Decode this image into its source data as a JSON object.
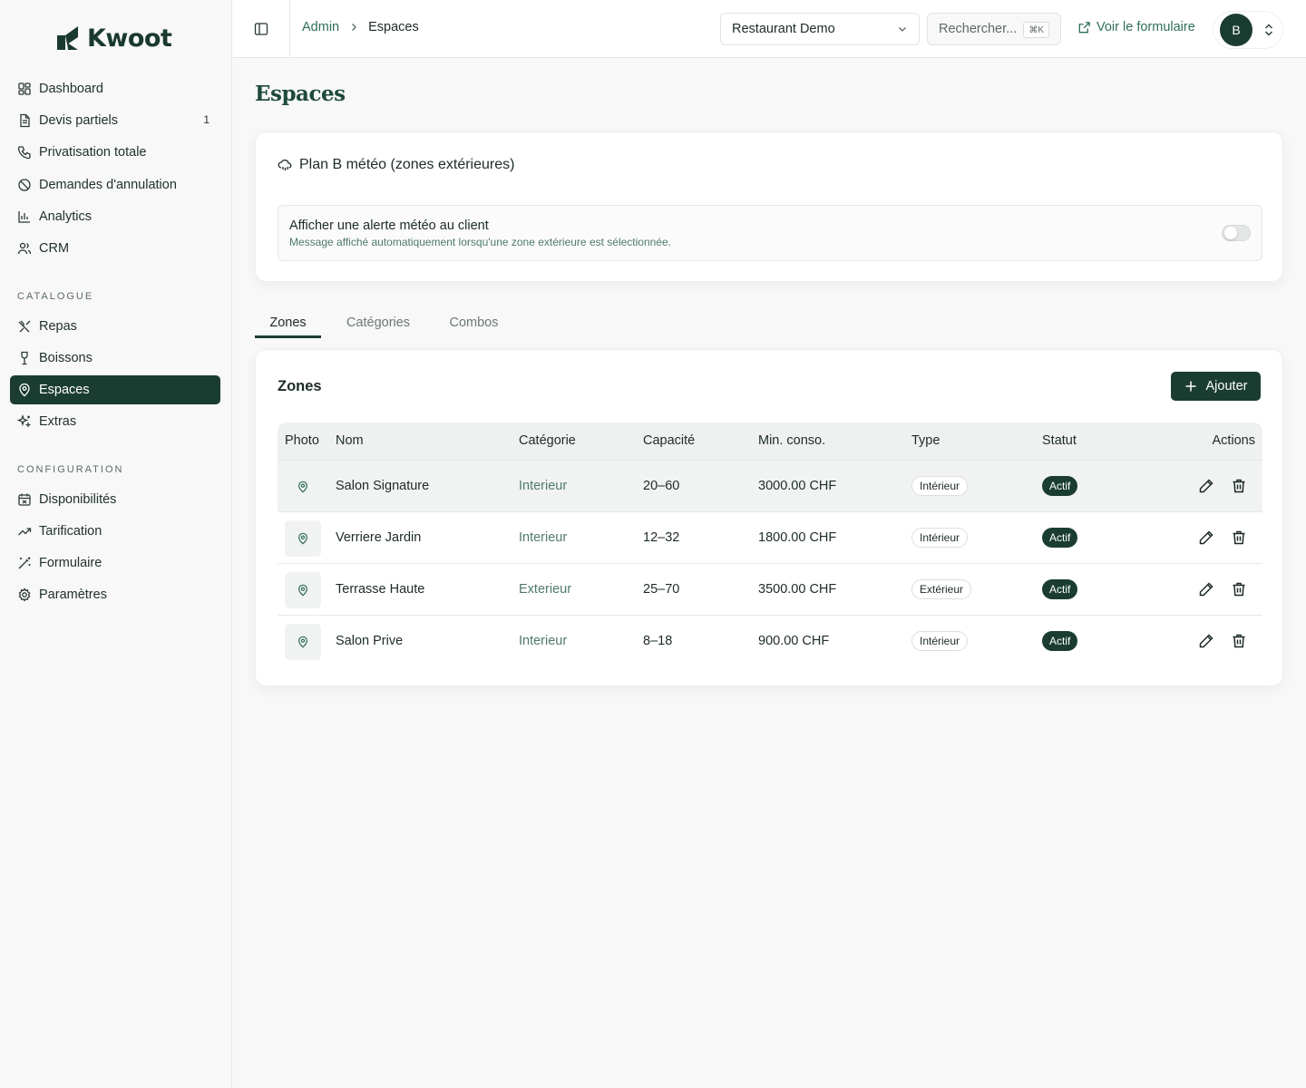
{
  "brand": {
    "name": "Kwoot"
  },
  "sidebar": {
    "items": [
      {
        "label": "Dashboard",
        "icon": "layout-dashboard-icon"
      },
      {
        "label": "Devis partiels",
        "icon": "file-text-icon",
        "badge": "1"
      },
      {
        "label": "Privatisation totale",
        "icon": "phone-icon"
      },
      {
        "label": "Demandes d'annulation",
        "icon": "ban-icon"
      },
      {
        "label": "Analytics",
        "icon": "bar-chart-icon"
      },
      {
        "label": "CRM",
        "icon": "users-icon"
      }
    ],
    "catalogue_label": "CATALOGUE",
    "catalogue_items": [
      {
        "label": "Repas",
        "icon": "utensils-icon"
      },
      {
        "label": "Boissons",
        "icon": "wine-icon"
      },
      {
        "label": "Espaces",
        "icon": "map-pin-icon",
        "active": true
      },
      {
        "label": "Extras",
        "icon": "sparkles-icon"
      }
    ],
    "config_label": "CONFIGURATION",
    "config_items": [
      {
        "label": "Disponibilités",
        "icon": "calendar-x-icon"
      },
      {
        "label": "Tarification",
        "icon": "trending-up-icon"
      },
      {
        "label": "Formulaire",
        "icon": "wand-icon"
      },
      {
        "label": "Paramètres",
        "icon": "settings-icon"
      }
    ]
  },
  "header": {
    "breadcrumb_parent": "Admin",
    "breadcrumb_current": "Espaces",
    "restaurant_select": "Restaurant Demo",
    "search_placeholder": "Rechercher...",
    "search_shortcut": "⌘K",
    "view_form_label": "Voir le formulaire",
    "avatar_initial": "B"
  },
  "page": {
    "title": "Espaces"
  },
  "weather": {
    "title": "Plan B météo (zones extérieures)",
    "alert_title": "Afficher une alerte météo au client",
    "alert_desc": "Message affiché automatiquement lorsqu'une zone extérieure est sélectionnée.",
    "alert_enabled": false
  },
  "tabs": [
    {
      "label": "Zones",
      "active": true
    },
    {
      "label": "Catégories",
      "active": false
    },
    {
      "label": "Combos",
      "active": false
    }
  ],
  "zones": {
    "title": "Zones",
    "add_label": "Ajouter",
    "columns": [
      "Photo",
      "Nom",
      "Catégorie",
      "Capacité",
      "Min. conso.",
      "Type",
      "Statut",
      "Actions"
    ],
    "rows": [
      {
        "name": "Salon Signature",
        "category": "Interieur",
        "capacity": "20–60",
        "min": "3000.00 CHF",
        "type": "Intérieur",
        "status": "Actif"
      },
      {
        "name": "Verriere Jardin",
        "category": "Interieur",
        "capacity": "12–32",
        "min": "1800.00 CHF",
        "type": "Intérieur",
        "status": "Actif"
      },
      {
        "name": "Terrasse Haute",
        "category": "Exterieur",
        "capacity": "25–70",
        "min": "3500.00 CHF",
        "type": "Extérieur",
        "status": "Actif"
      },
      {
        "name": "Salon Prive",
        "category": "Interieur",
        "capacity": "8–18",
        "min": "900.00 CHF",
        "type": "Intérieur",
        "status": "Actif"
      }
    ]
  },
  "colors": {
    "brand_dark": "#1b3d31",
    "accent_green": "#2f6e57",
    "muted_green": "#4f7a69"
  }
}
